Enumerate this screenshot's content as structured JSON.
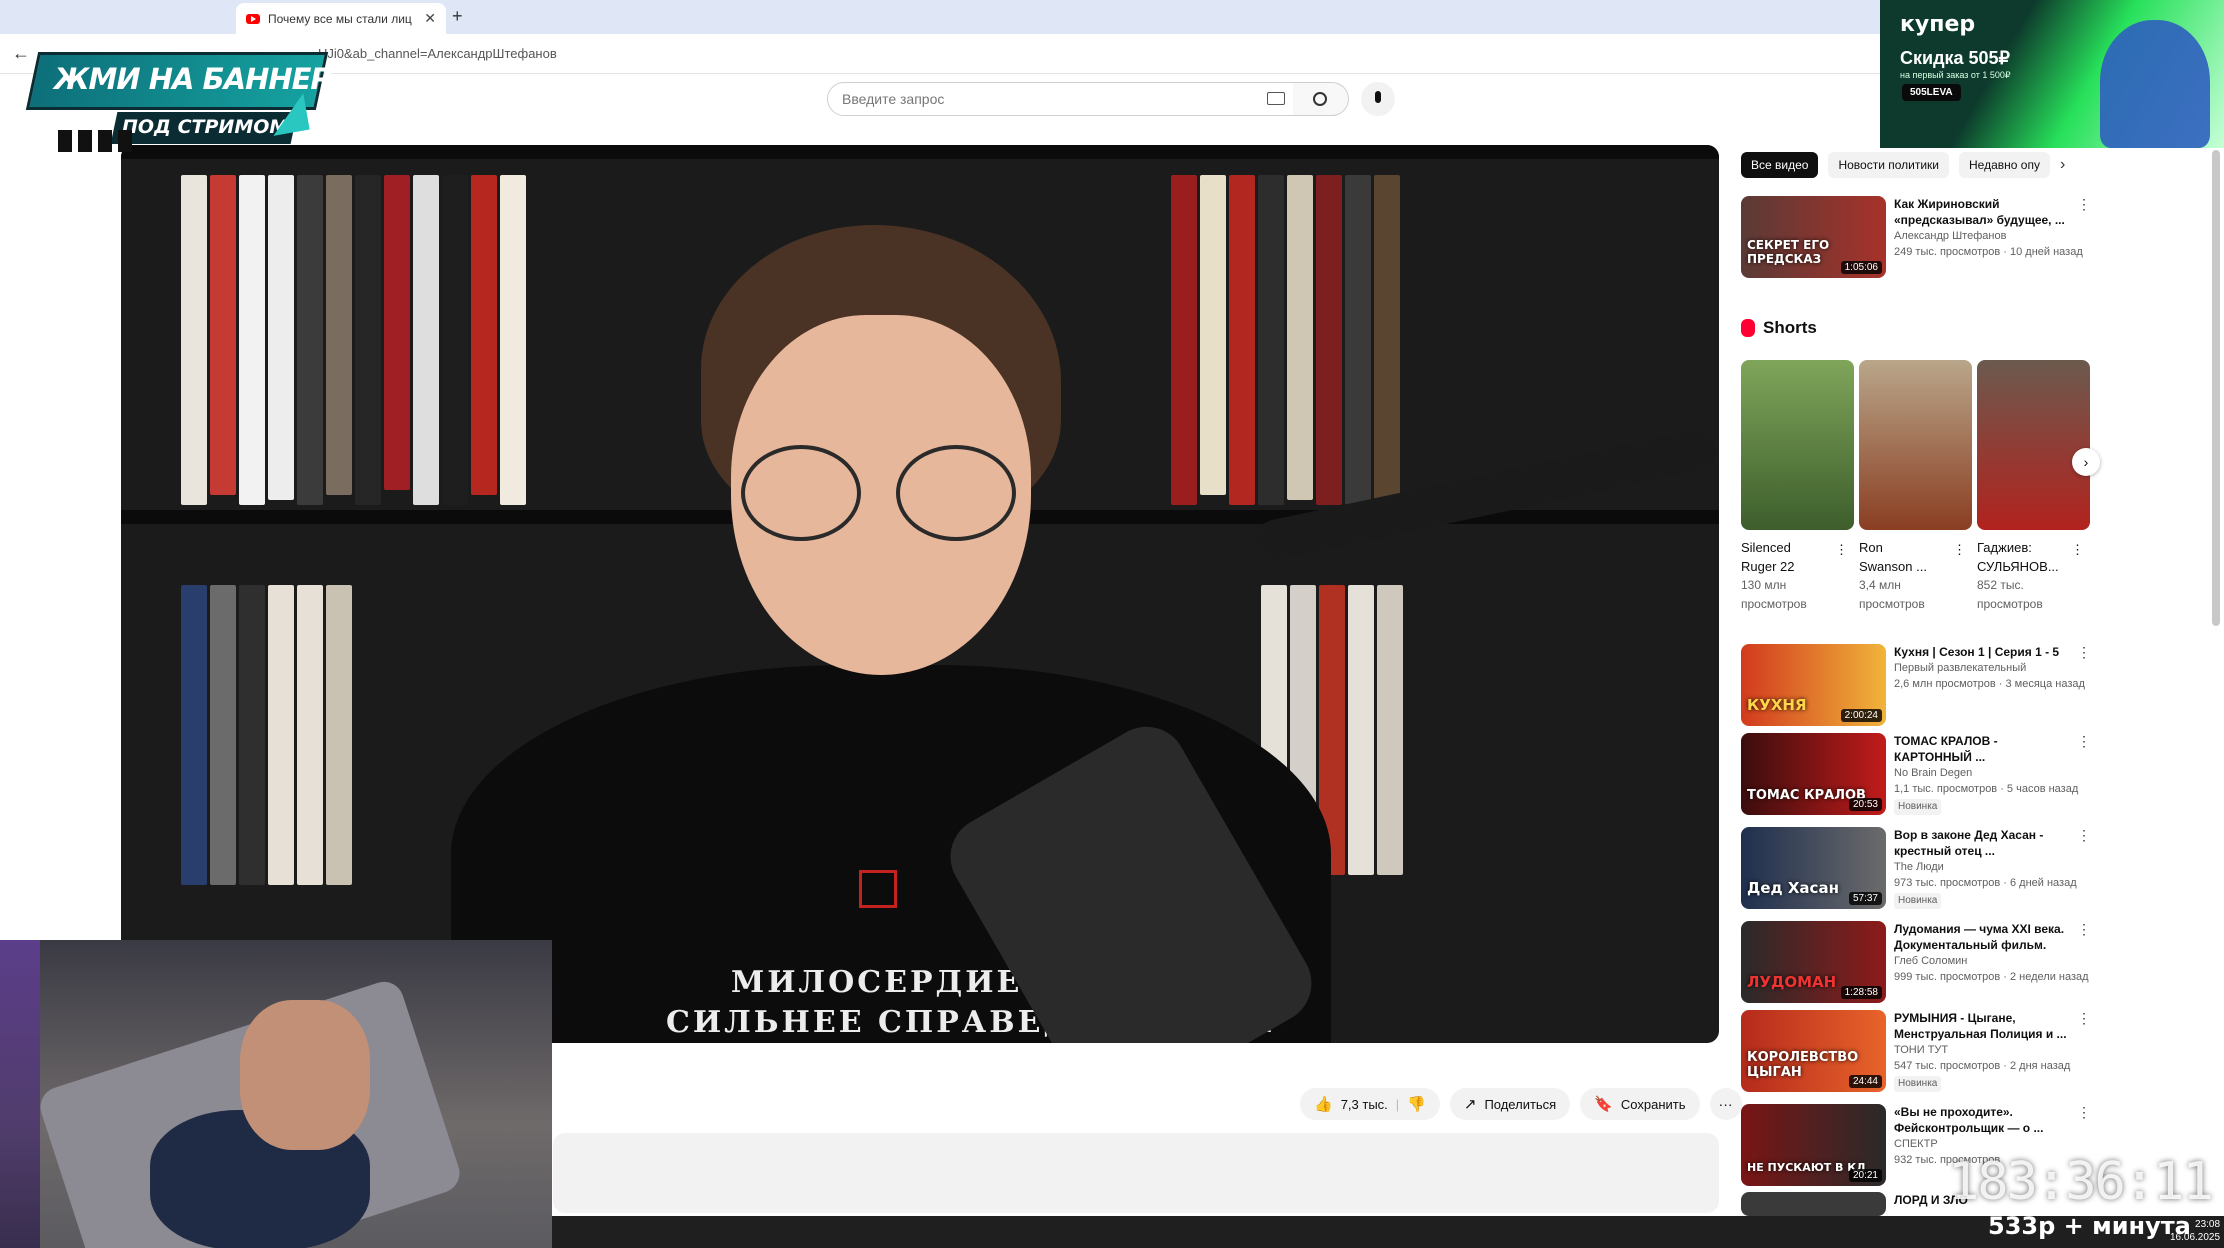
{
  "browser": {
    "tab_title": "Почему все мы стали лиц",
    "tab_close": "✕",
    "new_tab": "+",
    "back": "←",
    "url": "HJi0&ab_channel=АлександрШтефанов"
  },
  "header": {
    "search_placeholder": "Введите запрос"
  },
  "video": {
    "shirt_line1": "МИЛОСЕРДИЕ",
    "shirt_line2": "СИЛЬНЕЕ СПРАВЕДЛИВОСТИ",
    "likes": "7,3 тыс.",
    "share_label": "Поделиться",
    "save_label": "Сохранить",
    "more_label": "···"
  },
  "sidebar": {
    "chips": [
      "Все видео",
      "Новости политики",
      "Недавно опу"
    ],
    "chip_next": "›",
    "first_rec": {
      "title1": "Как Жириновский",
      "title2": "«предсказывал» будущее, ...",
      "channel": "Александр Штефанов",
      "stats": "249 тыс. просмотров · 10 дней назад",
      "duration": "1:05:06",
      "thumb_text": "СЕКРЕТ ЕГО ПРЕДСКАЗ"
    },
    "shorts_title": "Shorts",
    "shorts": [
      {
        "title1": "Silenced",
        "title2": "Ruger 22",
        "views1": "130 млн",
        "views2": "просмотров"
      },
      {
        "title1": "Ron",
        "title2": "Swanson ...",
        "views1": "3,4 млн",
        "views2": "просмотров"
      },
      {
        "title1": "Гаджиев:",
        "title2": "СУЛЬЯНОВ...",
        "views1": "852 тыс.",
        "views2": "просмотров"
      }
    ],
    "recs": [
      {
        "title1": "Кухня | Сезон 1 | Серия 1 - 5",
        "title2": "",
        "channel": "Первый развлекательный",
        "stats": "2,6 млн просмотров · 3 месяца назад",
        "badge": "",
        "duration": "2:00:24",
        "thumb_text": "КУХНЯ"
      },
      {
        "title1": "ТОМАС КРАЛОВ -",
        "title2": "КАРТОННЫЙ ...",
        "channel": "No Brain Degen",
        "stats": "1,1 тыс. просмотров · 5 часов назад",
        "badge": "Новинка",
        "duration": "20:53",
        "thumb_text": "ТОМАС КРАЛОВ"
      },
      {
        "title1": "Вор в законе Дед Хасан -",
        "title2": "крестный отец ...",
        "channel": "The Люди",
        "stats": "973 тыс. просмотров · 6 дней назад",
        "badge": "Новинка",
        "duration": "57:37",
        "thumb_text": "Дед Хасан"
      },
      {
        "title1": "Лудомания — чума XXI века.",
        "title2": "Документальный фильм.",
        "channel": "Глеб Соломин",
        "stats": "999 тыс. просмотров · 2 недели назад",
        "badge": "",
        "duration": "1:28:58",
        "thumb_text": "ЛУДОМАН"
      },
      {
        "title1": "РУМЫНИЯ - Цыгане,",
        "title2": "Менструальная Полиция и ...",
        "channel": "ТОНИ ТУТ",
        "stats": "547 тыс. просмотров · 2 дня назад",
        "badge": "Новинка",
        "duration": "24:44",
        "thumb_text": "КОРОЛЕВСТВО ЦЫГАН"
      },
      {
        "title1": "«Вы не проходите».",
        "title2": "Фейсконтрольщик — о ...",
        "channel": "СПЕКТР",
        "stats": "932 тыс. просмотров",
        "badge": "",
        "duration": "20:21",
        "thumb_text": "НЕ ПУСКАЮТ В КЛ"
      },
      {
        "title1": "ЛОРД И ЗЛО",
        "title2": "",
        "channel": "",
        "stats": "",
        "badge": "",
        "duration": "",
        "thumb_text": ""
      }
    ],
    "kebab": "⋮"
  },
  "overlay": {
    "banner_line1": "ЖМИ НА БАННЕР",
    "banner_line2": "ПОД СТРИМОМ",
    "ad_brand": "купер",
    "ad_promo": "Скидка 505₽",
    "ad_sub": "на первый заказ от 1 500₽",
    "ad_code": "505LEVA",
    "timer": "183:36:11",
    "rate": "533р + минута",
    "clock_time": "23:08",
    "clock_date": "16.06.2025"
  }
}
